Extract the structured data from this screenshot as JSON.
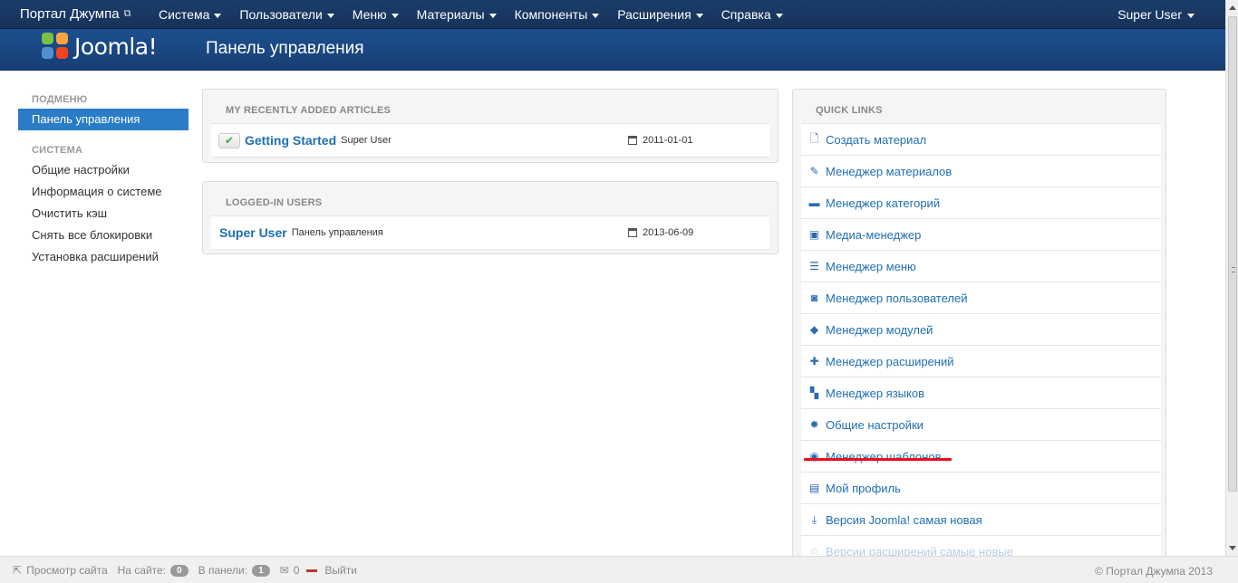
{
  "navbar": {
    "brand": "Портал Джумпа",
    "menu": [
      "Система",
      "Пользователи",
      "Меню",
      "Материалы",
      "Компоненты",
      "Расширения",
      "Справка"
    ],
    "user": "Super User"
  },
  "header": {
    "logo_text": "Joomla!",
    "title": "Панель управления"
  },
  "sidebar": {
    "submenu_title": "Подменю",
    "active_item": "Панель управления",
    "system_title": "Система",
    "system_items": [
      "Общие настройки",
      "Информация о системе",
      "Очистить кэш",
      "Снять все блокировки",
      "Установка расширений"
    ]
  },
  "recent_articles": {
    "title": "My Recently Added Articles",
    "rows": [
      {
        "title": "Getting Started",
        "author": "Super User",
        "date": "2011-01-01"
      }
    ]
  },
  "logged_in": {
    "title": "Logged-in Users",
    "rows": [
      {
        "name": "Super User",
        "location": "Панель управления",
        "date": "2013-06-09"
      }
    ]
  },
  "quick_links": {
    "title": "Quick Links",
    "items": [
      {
        "label": "Создать материал",
        "icon": "new-article-icon"
      },
      {
        "label": "Менеджер материалов",
        "icon": "pencil-icon"
      },
      {
        "label": "Менеджер категорий",
        "icon": "folder-icon"
      },
      {
        "label": "Медиа-менеджер",
        "icon": "image-icon"
      },
      {
        "label": "Менеджер меню",
        "icon": "list-icon"
      },
      {
        "label": "Менеджер пользователей",
        "icon": "user-icon"
      },
      {
        "label": "Менеджер модулей",
        "icon": "cube-icon"
      },
      {
        "label": "Менеджер расширений",
        "icon": "puzzle-icon"
      },
      {
        "label": "Менеджер языков",
        "icon": "comments-icon"
      },
      {
        "label": "Общие настройки",
        "icon": "cog-icon"
      },
      {
        "label": "Менеджер шаблонов",
        "icon": "eye-icon"
      },
      {
        "label": "Мой профиль",
        "icon": "profile-card-icon"
      },
      {
        "label": "Версия Joomla! самая новая",
        "icon": "download-icon"
      },
      {
        "label": "Версии расширений самые новые",
        "icon": "star-icon"
      }
    ]
  },
  "footer": {
    "view_site": "Просмотр сайта",
    "on_site_label": "На сайте:",
    "on_site_count": "0",
    "in_panel_label": "В панели:",
    "in_panel_count": "1",
    "messages_count": "0",
    "logout": "Выйти",
    "copyright": "© Портал Джумпа 2013"
  },
  "colors": {
    "navbar": "#1b3d6b",
    "header": "#1d4f8f",
    "accent": "#2a7cc7",
    "link": "#1f6fb2",
    "annotation": "#e8101a"
  }
}
